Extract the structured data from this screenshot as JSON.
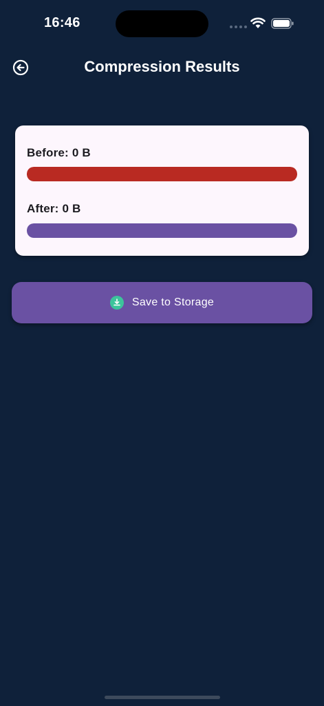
{
  "status_bar": {
    "time": "16:46"
  },
  "header": {
    "title": "Compression Results",
    "back_icon": "arrow-left-circle-icon"
  },
  "results": {
    "before_label": "Before: 0 B",
    "after_label": "After: 0 B",
    "before_fill_fraction": 1.0,
    "after_fill_fraction": 1.0,
    "before_color": "#b92a22",
    "after_color": "#6a51a3"
  },
  "actions": {
    "save_label": "Save to Storage",
    "save_icon": "download-icon",
    "save_icon_color": "#3cc49b",
    "button_color": "#6a51a3"
  },
  "theme": {
    "background": "#0f213a",
    "card_background": "#fdf6fd"
  }
}
